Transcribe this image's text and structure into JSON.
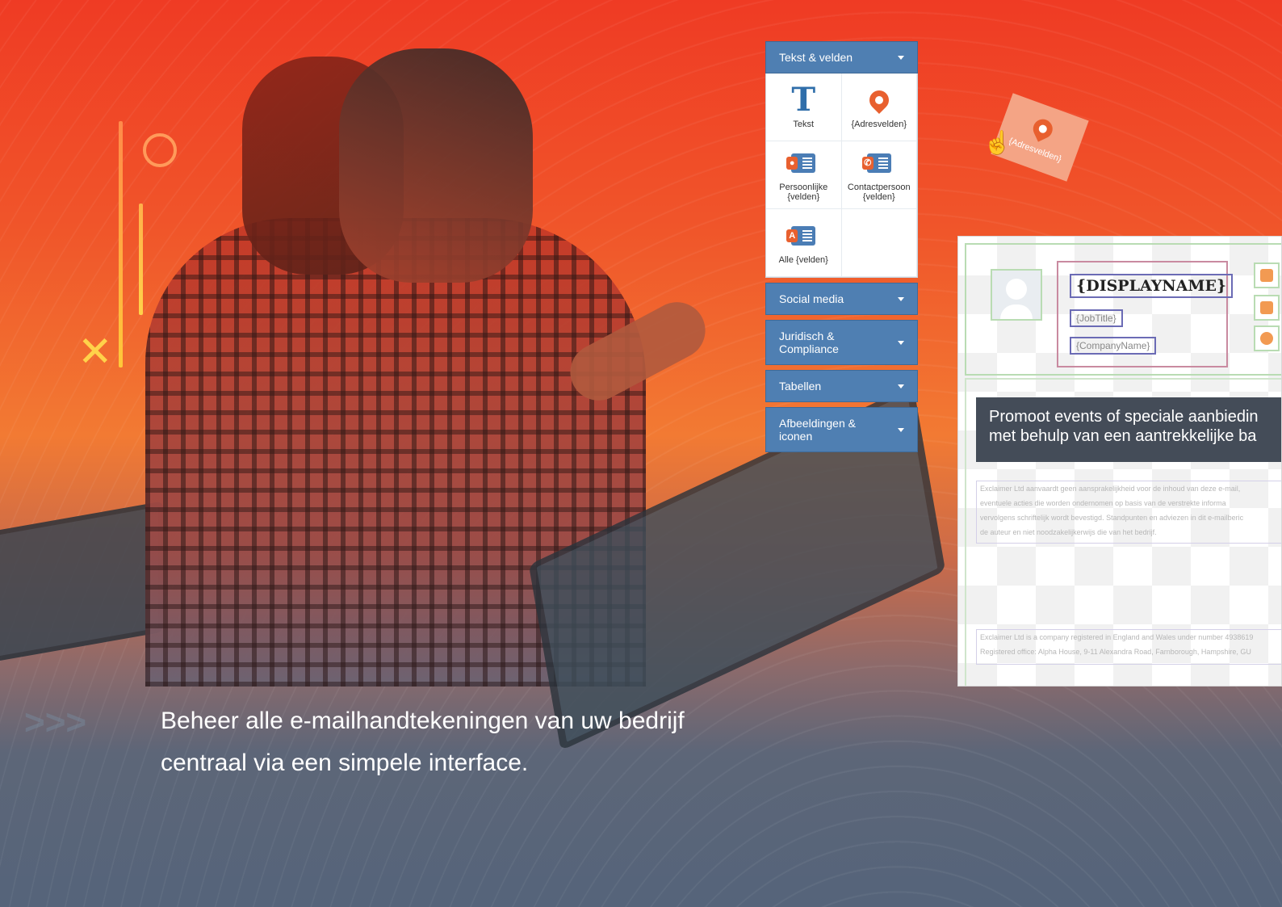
{
  "panel": {
    "header": "Tekst & velden",
    "tiles": [
      {
        "icon": "text-icon",
        "label": "Tekst"
      },
      {
        "icon": "address-pin-icon",
        "label": "{Adresvelden}"
      },
      {
        "icon": "personal-card-icon",
        "label": "Persoonlijke {velden}"
      },
      {
        "icon": "contact-card-icon",
        "label": "Contactpersoon {velden}"
      },
      {
        "icon": "all-fields-icon",
        "label": "Alle {velden}",
        "badge": "A"
      }
    ],
    "sections": [
      {
        "label": "Social media"
      },
      {
        "label": "Juridisch & Compliance"
      },
      {
        "label": "Tabellen"
      },
      {
        "label": "Afbeeldingen & iconen"
      }
    ]
  },
  "drag": {
    "label": "{Adresvelden}"
  },
  "editor": {
    "display_name": "{DISPLAYNAME}",
    "job_title": "{JobTitle}",
    "company_name": "{CompanyName}",
    "contact_icons": [
      "phone-icon",
      "mail-icon",
      "globe-icon"
    ],
    "banner_line1": "Promoot events of speciale aanbiedin",
    "banner_line2": "met behulp van een aantrekkelijke ba",
    "disclaimer_nl": [
      "Exclaimer Ltd aanvaardt geen aansprakelijkheid voor de inhoud van deze e-mail,",
      "eventuele acties die worden ondernomen op basis van de verstrekte informa",
      "vervolgens schriftelijk wordt bevestigd. Standpunten en adviezen in dit e-mailberic",
      "de auteur en niet noodzakelijkerwijs die van het bedrijf."
    ],
    "disclaimer_en": [
      "Exclaimer Ltd is a company registered in England and Wales under number 4938619",
      "Registered office: Alpha House, 9-11 Alexandra Road, Farnborough, Hampshire, GU"
    ]
  },
  "caption": {
    "line1": "Beheer alle e-mailhandtekeningen van uw bedrijf",
    "line2": "centraal via een simpele interface."
  },
  "colors": {
    "panel_header": "#4f7fb2",
    "accent_orange": "#e8602f",
    "background_top": "#ef3b24",
    "background_bottom": "#55647a"
  }
}
